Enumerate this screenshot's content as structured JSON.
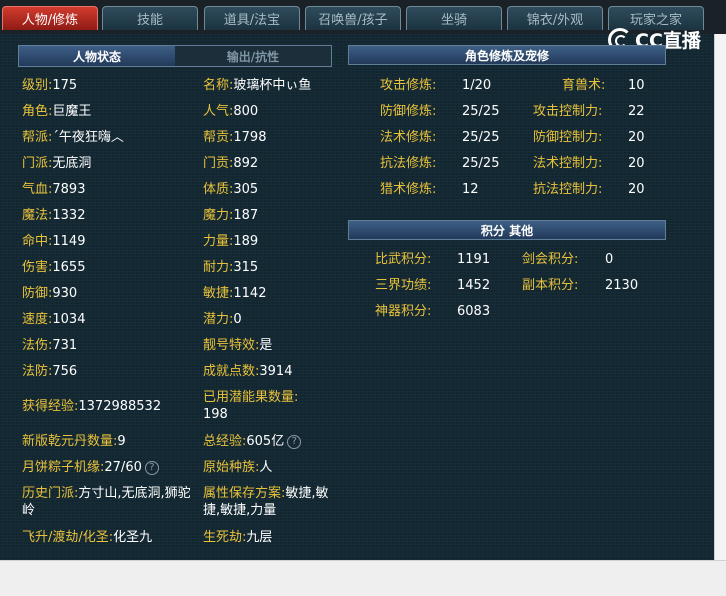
{
  "tabs": [
    {
      "label": "人物/修炼",
      "active": true
    },
    {
      "label": "技能",
      "active": false
    },
    {
      "label": "道具/法宝",
      "active": false
    },
    {
      "label": "召唤兽/孩子",
      "active": false
    },
    {
      "label": "坐骑",
      "active": false
    },
    {
      "label": "锦衣/外观",
      "active": false
    },
    {
      "label": "玩家之家",
      "active": false
    }
  ],
  "logo": {
    "text": "CC直播"
  },
  "subtabs": {
    "active": "人物状态",
    "inactive": "输出/抗性"
  },
  "left_col": [
    {
      "label": "级别:",
      "value": "175"
    },
    {
      "label": "角色:",
      "value": "巨魔王"
    },
    {
      "label": "帮派:",
      "value": "ˊ午夜狂嗨︿"
    },
    {
      "label": "门派:",
      "value": "无底洞"
    },
    {
      "label": "气血:",
      "value": "7893"
    },
    {
      "label": "魔法:",
      "value": "1332"
    },
    {
      "label": "命中:",
      "value": "1149"
    },
    {
      "label": "伤害:",
      "value": "1655"
    },
    {
      "label": "防御:",
      "value": "930"
    },
    {
      "label": "速度:",
      "value": "1034"
    },
    {
      "label": "法伤:",
      "value": "731"
    },
    {
      "label": "法防:",
      "value": "756"
    },
    {
      "label": "获得经验:",
      "value": "1372988532"
    },
    {
      "label": "新版乾元丹数量:",
      "value": "9"
    },
    {
      "label": "月饼粽子机缘:",
      "value": "27/60"
    },
    {
      "label": "历史门派:",
      "value": "方寸山,无底洞,狮驼岭"
    },
    {
      "label": "飞升/渡劫/化圣:",
      "value": "化圣九"
    }
  ],
  "mid_col": [
    {
      "label": "名称:",
      "value": "玻璃杯中ぃ鱼"
    },
    {
      "label": "人气:",
      "value": "800"
    },
    {
      "label": "帮贡:",
      "value": "1798"
    },
    {
      "label": "门贡:",
      "value": "892"
    },
    {
      "label": "体质:",
      "value": "305"
    },
    {
      "label": "魔力:",
      "value": "187"
    },
    {
      "label": "力量:",
      "value": "189"
    },
    {
      "label": "耐力:",
      "value": "315"
    },
    {
      "label": "敏捷:",
      "value": "1142"
    },
    {
      "label": "潜力:",
      "value": "0"
    },
    {
      "label": "靓号特效:",
      "value": "是"
    },
    {
      "label": "成就点数:",
      "value": "3914"
    },
    {
      "label": "已用潜能果数量:",
      "value": "198"
    },
    {
      "label": "总经验:",
      "value": "605亿"
    },
    {
      "label": "原始种族:",
      "value": "人"
    },
    {
      "label": "属性保存方案:",
      "value": "敏捷,敏捷,敏捷,力量"
    },
    {
      "label": "生死劫:",
      "value": "九层"
    }
  ],
  "cultivation": {
    "header": "角色修炼及宠修",
    "rows": [
      {
        "l_label": "攻击修炼:",
        "l_value": "1/20",
        "r_label": "育兽术:",
        "r_value": "10"
      },
      {
        "l_label": "防御修炼:",
        "l_value": "25/25",
        "r_label": "攻击控制力:",
        "r_value": "22"
      },
      {
        "l_label": "法术修炼:",
        "l_value": "25/25",
        "r_label": "防御控制力:",
        "r_value": "20"
      },
      {
        "l_label": "抗法修炼:",
        "l_value": "25/25",
        "r_label": "法术控制力:",
        "r_value": "20"
      },
      {
        "l_label": "猎术修炼:",
        "l_value": "12",
        "r_label": "抗法控制力:",
        "r_value": "20"
      }
    ]
  },
  "points": {
    "header": "积分 其他",
    "rows": [
      {
        "l_label": "比武积分:",
        "l_value": "1191",
        "r_label": "剑会积分:",
        "r_value": "0"
      },
      {
        "l_label": "三界功绩:",
        "l_value": "1452",
        "r_label": "副本积分:",
        "r_value": "2130"
      },
      {
        "l_label": "神器积分:",
        "l_value": "6083",
        "r_label": "",
        "r_value": ""
      }
    ]
  },
  "help_icon_text": "?"
}
